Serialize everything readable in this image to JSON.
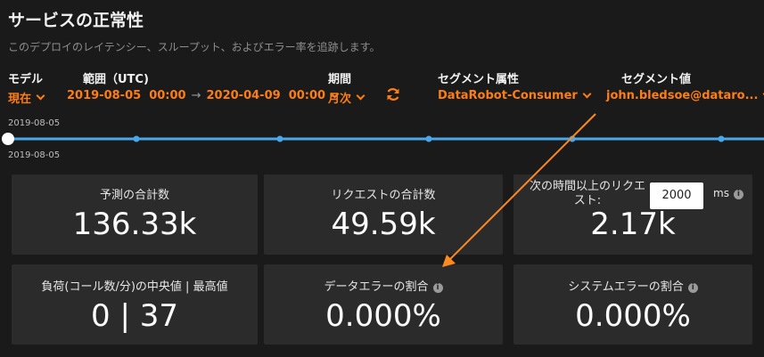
{
  "header": {
    "title": "サービスの正常性",
    "subtitle": "このデプロイのレイテンシー、スループット、およびエラー率を追跡します。"
  },
  "filters": {
    "model": {
      "label": "モデル",
      "value": "現在"
    },
    "range": {
      "label": "範囲（UTC)",
      "start": "2019-08-05  00:00",
      "arrow": "→",
      "end": "2020-04-09  00:00"
    },
    "period": {
      "label": "期間",
      "value": "月次"
    },
    "segment_attr": {
      "label": "セグメント属性",
      "value": "DataRobot-Consumer"
    },
    "segment_val": {
      "label": "セグメント値",
      "value": "john.bledsoe@dataro..."
    }
  },
  "timeline": {
    "date_top": "2019-08-05",
    "date_bottom": "2019-08-05"
  },
  "cards": {
    "total_predictions": {
      "title": "予測の合計数",
      "value": "136.33k"
    },
    "total_requests": {
      "title": "リクエストの合計数",
      "value": "49.59k"
    },
    "slow_requests": {
      "title_line1": "次の時間以上のリクエ",
      "title_line2": "スト:",
      "threshold": "2000",
      "unit": "ms",
      "value": "2.17k"
    },
    "load": {
      "title": "負荷(コール数/分)の中央値 | 最高値",
      "value": "0 | 37"
    },
    "data_error": {
      "title": "データエラーの割合",
      "value": "0.000%"
    },
    "system_error": {
      "title": "システムエラーの割合",
      "value": "0.000%"
    }
  },
  "colors": {
    "accent": "#ff7e14",
    "timeline": "#4aa8e8",
    "card_bg": "#2b2b2b",
    "background": "#1a1a1a"
  },
  "icons": {
    "refresh": "refresh-icon",
    "info": "info-icon",
    "chevron": "chevron-down-icon"
  }
}
